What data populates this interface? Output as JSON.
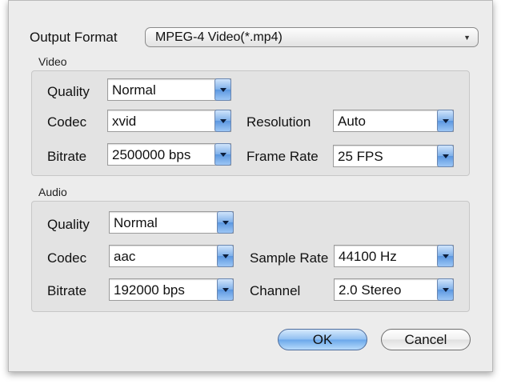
{
  "output_format": {
    "label": "Output Format",
    "value": "MPEG-4 Video(*.mp4)"
  },
  "video": {
    "title": "Video",
    "quality_label": "Quality",
    "quality_value": "Normal",
    "codec_label": "Codec",
    "codec_value": "xvid",
    "bitrate_label": "Bitrate",
    "bitrate_value": "2500000 bps",
    "resolution_label": "Resolution",
    "resolution_value": "Auto",
    "framerate_label": "Frame Rate",
    "framerate_value": "25 FPS"
  },
  "audio": {
    "title": "Audio",
    "quality_label": "Quality",
    "quality_value": "Normal",
    "codec_label": "Codec",
    "codec_value": "aac",
    "bitrate_label": "Bitrate",
    "bitrate_value": "192000 bps",
    "samplerate_label": "Sample Rate",
    "samplerate_value": "44100 Hz",
    "channel_label": "Channel",
    "channel_value": "2.0 Stereo"
  },
  "buttons": {
    "ok": "OK",
    "cancel": "Cancel"
  },
  "icons": {
    "popup_arrow": "chevron-down-icon",
    "combo_arrow": "chevron-down-icon"
  },
  "colors": {
    "dialog_bg": "#ececec",
    "group_bg": "#e3e3e3",
    "accent_blue": "#6aa7ea"
  }
}
